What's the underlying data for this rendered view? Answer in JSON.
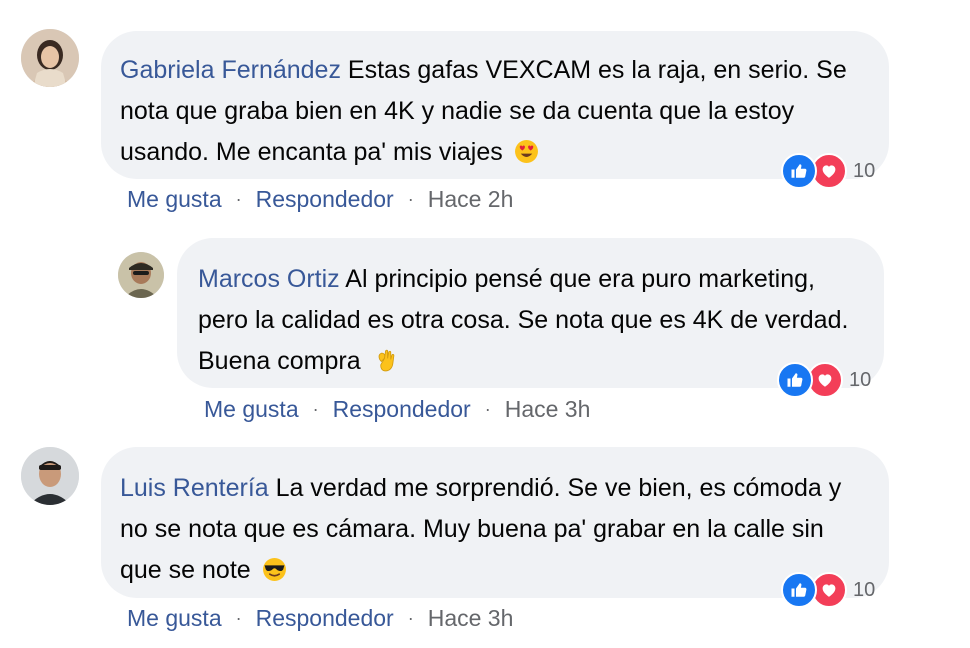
{
  "comments": [
    {
      "author": "Gabriela Fernández",
      "text": "Estas gafas VEXCAM es la raja, en serio. Se nota que graba bien en 4K y nadie se da cuenta que la estoy usando. Me encanta pa' mis viajes",
      "emoji": "heart-eyes-emoji",
      "reaction_count": "10",
      "like_label": "Me gusta",
      "reply_label": "Respondedor",
      "time": "Hace 2h"
    },
    {
      "author": "Marcos Ortiz",
      "text": "Al principio pensé que era puro marketing, pero la calidad es otra cosa. Se nota que es 4K de verdad. Buena compra",
      "emoji": "ok-hand-emoji",
      "reaction_count": "10",
      "like_label": "Me gusta",
      "reply_label": "Respondedor",
      "time": "Hace 3h"
    },
    {
      "author": "Luis Rentería",
      "text": "La verdad me sorprendió. Se ve bien, es cómoda y no se nota que es cámara. Muy buena pa' grabar en la calle sin que se note",
      "emoji": "sunglasses-emoji",
      "reaction_count": "10",
      "like_label": "Me gusta",
      "reply_label": "Respondedor",
      "time": "Hace 3h"
    }
  ],
  "colors": {
    "author": "#385898",
    "bubble": "#f0f2f5",
    "meta": "#65676b",
    "like": "#1877f2",
    "love": "#f33e58"
  }
}
